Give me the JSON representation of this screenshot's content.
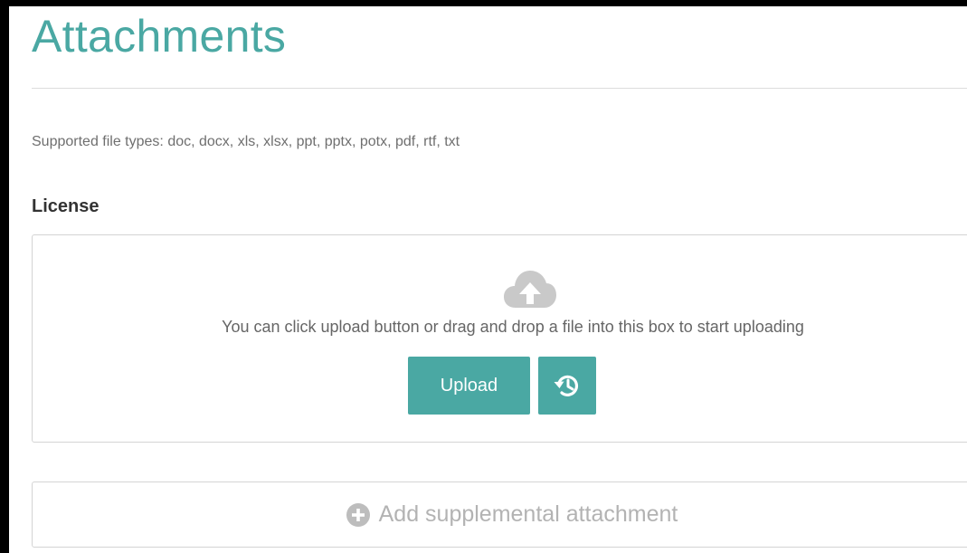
{
  "page": {
    "title": "Attachments",
    "supported_types": "Supported file types: doc, docx, xls, xlsx, ppt, pptx, potx, pdf, rtf, txt"
  },
  "license": {
    "label": "License",
    "drop_hint": "You can click upload button or drag and drop a file into this box to start uploading",
    "upload_label": "Upload",
    "upload_icon": "cloud-upload-icon",
    "restore_icon": "history-icon"
  },
  "supplemental": {
    "add_label": "Add supplemental attachment",
    "icon": "plus-circle-icon"
  },
  "colors": {
    "accent": "#4aa8a3",
    "muted_text": "#6f6f6f",
    "icon_gray": "#c9c9c9",
    "border": "#d4d4d4"
  }
}
